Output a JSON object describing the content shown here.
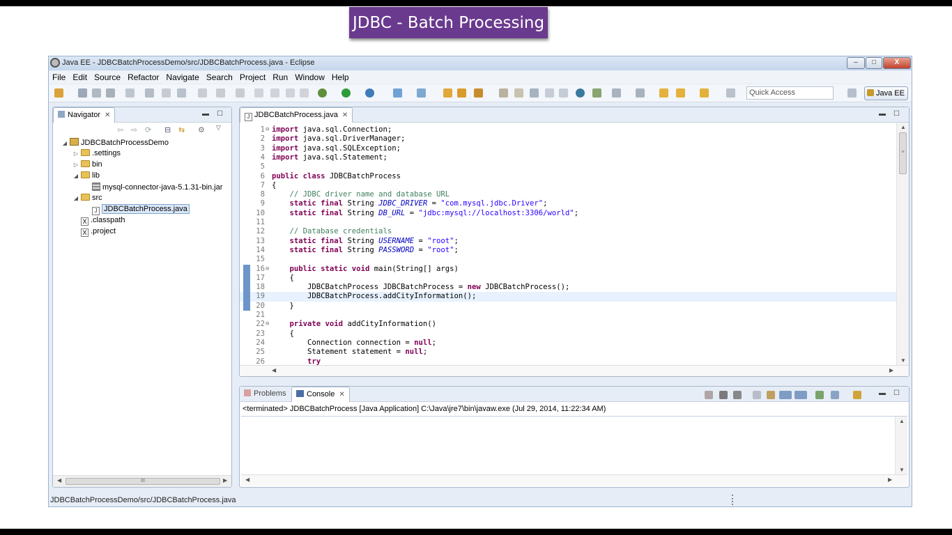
{
  "banner": {
    "title": "JDBC - Batch Processing"
  },
  "window": {
    "title": "Java EE - JDBCBatchProcessDemo/src/JDBCBatchProcess.java - Eclipse",
    "minimize": "–",
    "maximize": "□",
    "close": "X"
  },
  "menu": [
    "File",
    "Edit",
    "Source",
    "Refactor",
    "Navigate",
    "Search",
    "Project",
    "Run",
    "Window",
    "Help"
  ],
  "toolbar": {
    "quick_access_placeholder": "Quick Access",
    "perspective_label": "Java EE"
  },
  "navigator": {
    "tab_label": "Navigator",
    "tree": [
      {
        "label": "JDBCBatchProcessDemo",
        "level": 0,
        "kind": "project",
        "expanded": true
      },
      {
        "label": ".settings",
        "level": 1,
        "kind": "folder",
        "expanded": false
      },
      {
        "label": "bin",
        "level": 1,
        "kind": "folder",
        "expanded": false
      },
      {
        "label": "lib",
        "level": 1,
        "kind": "folder",
        "expanded": true
      },
      {
        "label": "mysql-connector-java-5.1.31-bin.jar",
        "level": 2,
        "kind": "jar"
      },
      {
        "label": "src",
        "level": 1,
        "kind": "folder",
        "expanded": true
      },
      {
        "label": "JDBCBatchProcess.java",
        "level": 2,
        "kind": "java",
        "selected": true
      },
      {
        "label": ".classpath",
        "level": 1,
        "kind": "xml"
      },
      {
        "label": ".project",
        "level": 1,
        "kind": "xml"
      }
    ],
    "scroll_thumb": "III"
  },
  "editor": {
    "tab_label": "JDBCBatchProcess.java",
    "current_line": 19,
    "lines": [
      {
        "n": "1",
        "fold": "⊖",
        "html": "<span class=\"kw\">import</span> java.sql.Connection;"
      },
      {
        "n": "2",
        "html": "<span class=\"kw\">import</span> java.sql.DriverManager;"
      },
      {
        "n": "3",
        "html": "<span class=\"kw\">import</span> java.sql.SQLException;"
      },
      {
        "n": "4",
        "html": "<span class=\"kw\">import</span> java.sql.Statement;"
      },
      {
        "n": "5",
        "html": ""
      },
      {
        "n": "6",
        "html": "<span class=\"kw\">public class</span> JDBCBatchProcess"
      },
      {
        "n": "7",
        "html": "{"
      },
      {
        "n": "8",
        "html": "    <span class=\"cm\">// JDBC driver name and database URL</span>"
      },
      {
        "n": "9",
        "html": "    <span class=\"kw\">static final</span> String <span class=\"fi\">JDBC_DRIVER</span> = <span class=\"st\">\"com.mysql.jdbc.Driver\"</span>;"
      },
      {
        "n": "10",
        "html": "    <span class=\"kw\">static final</span> String <span class=\"fi\">DB_URL</span> = <span class=\"st\">\"jdbc:mysql://localhost:3306/world\"</span>;"
      },
      {
        "n": "11",
        "html": ""
      },
      {
        "n": "12",
        "html": "    <span class=\"cm\">// Database credentials</span>"
      },
      {
        "n": "13",
        "html": "    <span class=\"kw\">static final</span> String <span class=\"fi\">USERNAME</span> = <span class=\"st\">\"root\"</span>;"
      },
      {
        "n": "14",
        "html": "    <span class=\"kw\">static final</span> String <span class=\"fi\">PASSWORD</span> = <span class=\"st\">\"root\"</span>;"
      },
      {
        "n": "15",
        "html": ""
      },
      {
        "n": "16",
        "fold": "⊖",
        "html": "    <span class=\"kw\">public static void</span> main(String[] args)"
      },
      {
        "n": "17",
        "html": "    {"
      },
      {
        "n": "18",
        "html": "        JDBCBatchProcess JDBCBatchProcess = <span class=\"kw\">new</span> JDBCBatchProcess();"
      },
      {
        "n": "19",
        "html": "        JDBCBatchProcess.addCityInformation();"
      },
      {
        "n": "20",
        "html": "    }"
      },
      {
        "n": "21",
        "html": ""
      },
      {
        "n": "22",
        "fold": "⊖",
        "html": "    <span class=\"kw\">private void</span> addCityInformation()"
      },
      {
        "n": "23",
        "html": "    {"
      },
      {
        "n": "24",
        "html": "        Connection connection = <span class=\"kw\">null</span>;"
      },
      {
        "n": "25",
        "html": "        Statement statement = <span class=\"kw\">null</span>;"
      },
      {
        "n": "26",
        "html": "        <span class=\"kw\">try</span>"
      }
    ]
  },
  "bottom_panel": {
    "tabs": [
      "Problems",
      "Console"
    ],
    "console_header": "<terminated> JDBCBatchProcess [Java Application] C:\\Java\\jre7\\bin\\javaw.exe (Jul 29, 2014, 11:22:34 AM)"
  },
  "status": {
    "path": "JDBCBatchProcessDemo/src/JDBCBatchProcess.java"
  }
}
